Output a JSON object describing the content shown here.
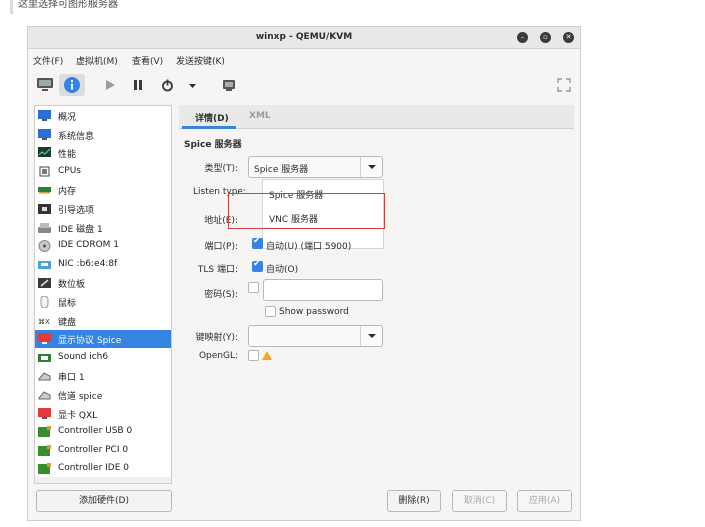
{
  "caption": "这里选择可图形服务器",
  "window": {
    "title": "winxp - QEMU/KVM"
  },
  "menubar": [
    "文件(F)",
    "虚拟机(M)",
    "查看(V)",
    "发送按键(K)"
  ],
  "toolbar": {
    "icons": [
      "monitor-icon",
      "info-icon",
      "play-icon",
      "pause-icon",
      "power-icon",
      "dropdown-icon",
      "snapshot-icon",
      "fullscreen-icon"
    ]
  },
  "sidebar": {
    "selected_index": 12,
    "items": [
      {
        "label": "概况",
        "icon": "overview-icon"
      },
      {
        "label": "系统信息",
        "icon": "system-info-icon"
      },
      {
        "label": "性能",
        "icon": "performance-icon"
      },
      {
        "label": "CPUs",
        "icon": "cpu-icon"
      },
      {
        "label": "内存",
        "icon": "memory-icon"
      },
      {
        "label": "引导选项",
        "icon": "boot-icon"
      },
      {
        "label": "IDE 磁盘 1",
        "icon": "disk-icon"
      },
      {
        "label": "IDE CDROM 1",
        "icon": "cdrom-icon"
      },
      {
        "label": "NIC :b6:e4:8f",
        "icon": "nic-icon"
      },
      {
        "label": "数位板",
        "icon": "tablet-icon"
      },
      {
        "label": "鼠标",
        "icon": "mouse-icon"
      },
      {
        "label": "键盘",
        "icon": "keyboard-icon"
      },
      {
        "label": "显示协议 Spice",
        "icon": "display-icon"
      },
      {
        "label": "Sound ich6",
        "icon": "sound-icon"
      },
      {
        "label": "串口 1",
        "icon": "serial-icon"
      },
      {
        "label": "信道 spice",
        "icon": "channel-icon"
      },
      {
        "label": "显卡 QXL",
        "icon": "video-icon"
      },
      {
        "label": "Controller USB 0",
        "icon": "controller-icon"
      },
      {
        "label": "Controller PCI 0",
        "icon": "controller-icon"
      },
      {
        "label": "Controller IDE 0",
        "icon": "controller-icon"
      }
    ],
    "add_hardware": "添加硬件(D)"
  },
  "tabs": {
    "details": "详情(D)",
    "xml": "XML"
  },
  "form": {
    "section": "Spice 服务器",
    "type_label": "类型(T):",
    "type_value": "Spice 服务器",
    "listen_label": "Listen type:",
    "address_label": "地址(E):",
    "port_label": "端口(P):",
    "port_auto": "自动(U) (端口 5900)",
    "tls_label": "TLS 端口:",
    "tls_auto": "自动(O)",
    "password_label": "密码(S):",
    "show_password": "Show password",
    "keymap_label": "键映射(Y):",
    "opengl_label": "OpenGL:"
  },
  "dropdown": {
    "options": [
      "Spice 服务器",
      "VNC 服务器"
    ],
    "highlighted": "VNC 服务器"
  },
  "buttons": {
    "remove": "删除(R)",
    "cancel": "取消(C)",
    "apply": "应用(A)"
  },
  "colors": {
    "accent": "#3584e4",
    "highlight_box": "#d23f3f",
    "warning": "#f5a623"
  }
}
